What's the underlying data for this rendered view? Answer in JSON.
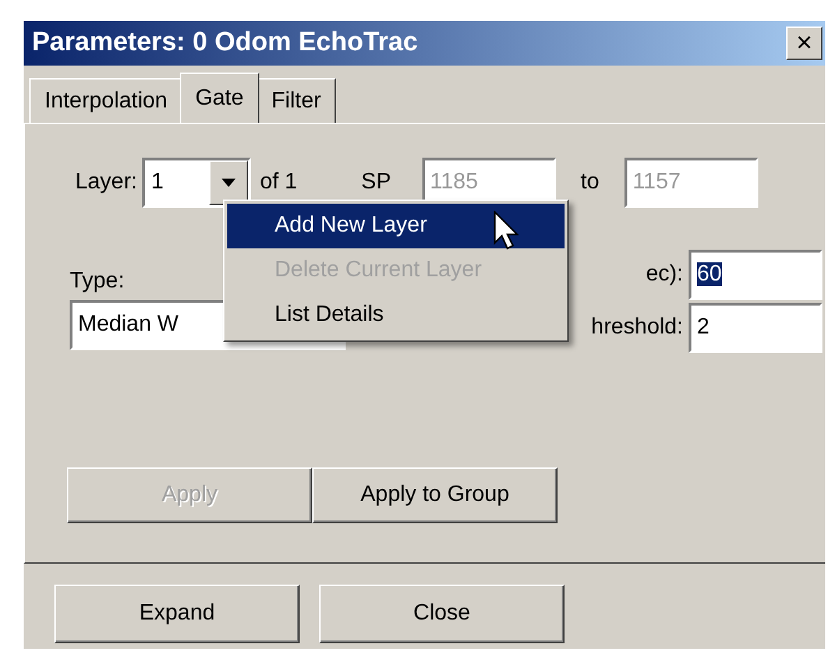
{
  "window": {
    "title": "Parameters: 0 Odom EchoTrac",
    "close": "×"
  },
  "tabs": [
    {
      "label": "Interpolation",
      "selected": false
    },
    {
      "label": "Gate",
      "selected": true
    },
    {
      "label": "Filter",
      "selected": false
    }
  ],
  "layer": {
    "label": "Layer:",
    "value": "1",
    "of": "of  1",
    "sp_label": "SP",
    "from": "1185",
    "to_label": "to",
    "to": "1157"
  },
  "type": {
    "label": "Type:",
    "value": "Median W"
  },
  "fields": [
    {
      "label": "ec):",
      "value": "60",
      "selected": true
    },
    {
      "label": "hreshold:",
      "value": "2",
      "selected": false
    }
  ],
  "actions": [
    {
      "label": "Apply",
      "disabled": true
    },
    {
      "label": "Apply to Group",
      "disabled": false
    }
  ],
  "menu": [
    {
      "label": "Add New Layer",
      "highlighted": true,
      "disabled": false
    },
    {
      "label": "Delete Current Layer",
      "highlighted": false,
      "disabled": true
    },
    {
      "label": "List Details",
      "highlighted": false,
      "disabled": false
    }
  ],
  "buttons": [
    "Expand",
    "Close"
  ]
}
